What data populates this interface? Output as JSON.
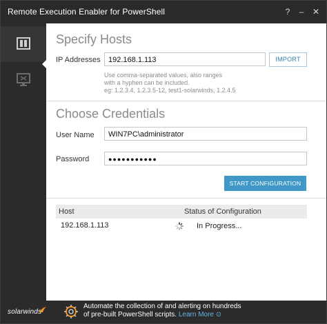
{
  "window": {
    "title": "Remote Execution Enabler for PowerShell",
    "help": "?",
    "minimize": "–",
    "close": "✕"
  },
  "sidebar": {
    "items": [
      {
        "icon": "panel-icon",
        "active": true
      },
      {
        "icon": "monitor-icon",
        "active": false
      }
    ]
  },
  "hosts": {
    "title": "Specify Hosts",
    "ip_label": "IP Addresses",
    "ip_value": "192.168.1.113",
    "import_label": "IMPORT",
    "hint_line1": "Use comma-separated values, also ranges",
    "hint_line2": "with a hyphen can be included.",
    "hint_line3": "eg: 1.2.3.4, 1.2.3.5-12, test1-solarwinds, 1.2.4.5"
  },
  "credentials": {
    "title": "Choose Credentials",
    "user_label": "User Name",
    "user_value": "WIN7PC\\administrator",
    "password_label": "Password",
    "password_value": "●●●●●●●●●●●",
    "start_label": "START CONFIGURATION"
  },
  "results": {
    "columns": [
      "Host",
      "Status of Configuration"
    ],
    "rows": [
      {
        "host": "192.168.1.113",
        "status": "In Progress..."
      }
    ]
  },
  "footer": {
    "logo": "solarwinds",
    "promo_line1": "Automate the collection of and alerting on hundreds",
    "promo_line2": "of pre-built PowerShell scripts.",
    "promo_link": "Learn More",
    "promo_arrow": "⊙"
  },
  "colors": {
    "accent": "#3f98c5",
    "titlebar": "#2a2a2a",
    "sidebar": "#2b2b2b",
    "logo_flame": "#f29221"
  }
}
